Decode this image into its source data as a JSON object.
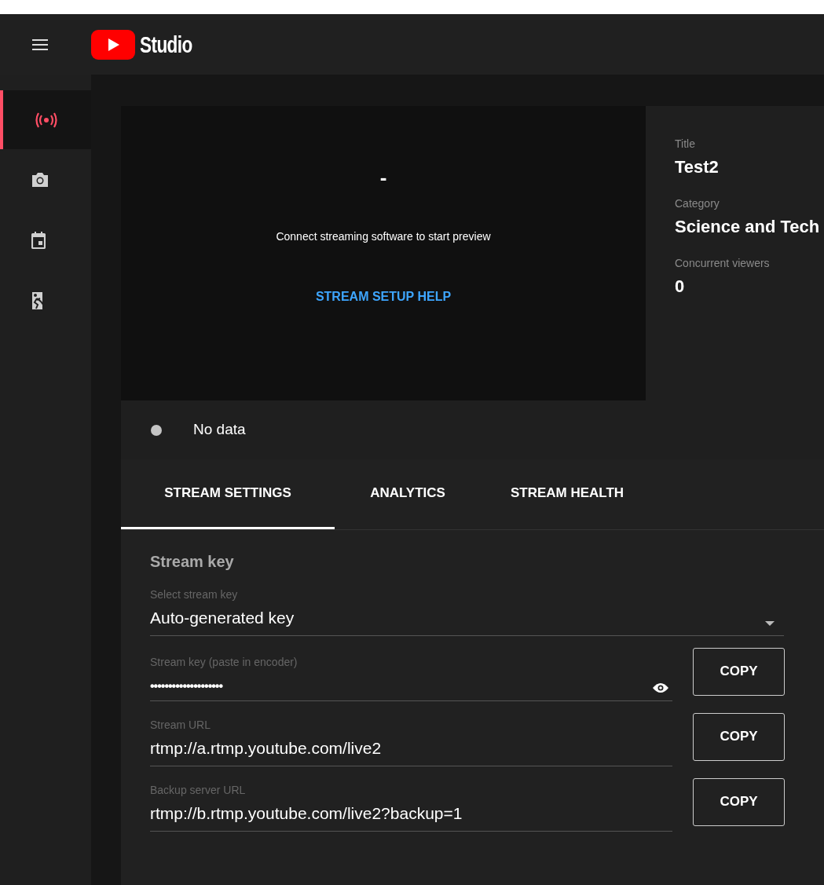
{
  "header": {
    "app_name": "Studio"
  },
  "sidebar": {
    "items": [
      {
        "kind": "live",
        "selected": true
      },
      {
        "kind": "camera",
        "selected": false
      },
      {
        "kind": "calendar",
        "selected": false
      },
      {
        "kind": "exit",
        "selected": false
      }
    ]
  },
  "preview": {
    "status_symbol": "-",
    "message": "Connect streaming software to start preview",
    "help_link": "STREAM SETUP HELP"
  },
  "details": [
    {
      "label": "Title",
      "value": "Test2"
    },
    {
      "label": "Category",
      "value": "Science and Tech"
    },
    {
      "label": "Concurrent viewers",
      "value": "0"
    }
  ],
  "stream_status": {
    "color": "#c4c4c4",
    "text": "No data"
  },
  "tabs": [
    {
      "label": "STREAM SETTINGS",
      "selected": true
    },
    {
      "label": "ANALYTICS",
      "selected": false
    },
    {
      "label": "STREAM HEALTH",
      "selected": false
    }
  ],
  "section_title": "Stream key",
  "fields": [
    {
      "kind": "dropdown",
      "label": "Select stream key",
      "value": "Auto-generated key"
    },
    {
      "kind": "secret",
      "label": "Stream key (paste in encoder)",
      "value": "••••••••••••••••••••",
      "button": "COPY"
    },
    {
      "kind": "text",
      "label": "Stream URL",
      "value": "rtmp://a.rtmp.youtube.com/live2",
      "button": "COPY"
    },
    {
      "kind": "text",
      "label": "Backup server URL",
      "value": "rtmp://b.rtmp.youtube.com/live2?backup=1",
      "button": "COPY"
    }
  ]
}
